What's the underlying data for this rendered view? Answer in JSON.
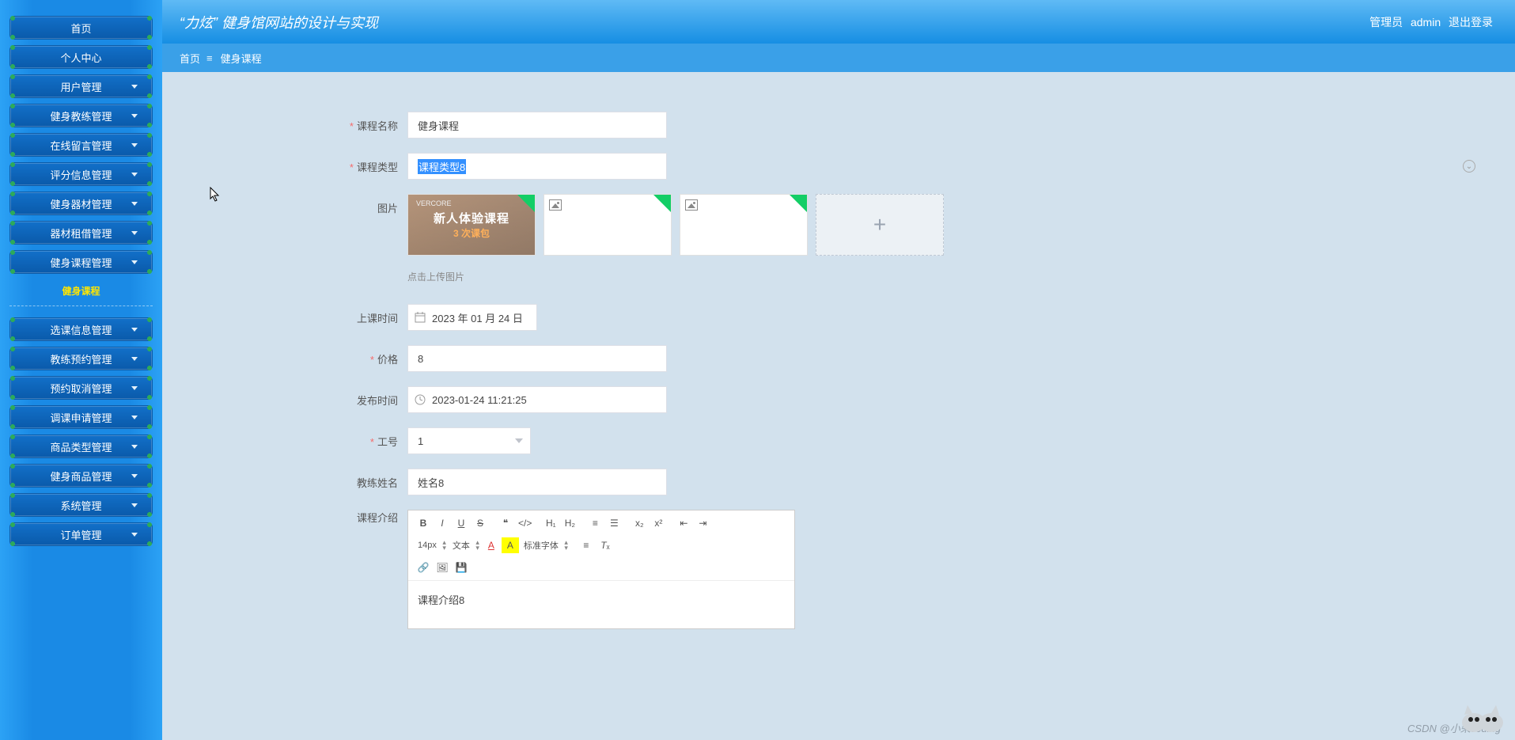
{
  "header": {
    "title": "“力炫” 健身馆网站的设计与实现",
    "role": "管理员",
    "user": "admin",
    "logout": "退出登录"
  },
  "breadcrumb": {
    "home": "首页",
    "current": "健身课程"
  },
  "sidebar": {
    "group1": [
      {
        "label": "首页"
      },
      {
        "label": "个人中心"
      },
      {
        "label": "用户管理",
        "sub": true
      },
      {
        "label": "健身教练管理",
        "sub": true
      },
      {
        "label": "在线留言管理",
        "sub": true
      },
      {
        "label": "评分信息管理",
        "sub": true
      },
      {
        "label": "健身器材管理",
        "sub": true
      },
      {
        "label": "器材租借管理",
        "sub": true
      },
      {
        "label": "健身课程管理",
        "sub": true
      }
    ],
    "active_sub": "健身课程",
    "group2": [
      {
        "label": "选课信息管理",
        "sub": true
      },
      {
        "label": "教练预约管理",
        "sub": true
      },
      {
        "label": "预约取消管理",
        "sub": true
      },
      {
        "label": "调课申请管理",
        "sub": true
      },
      {
        "label": "商品类型管理",
        "sub": true
      },
      {
        "label": "健身商品管理",
        "sub": true
      },
      {
        "label": "系统管理",
        "sub": true
      },
      {
        "label": "订单管理",
        "sub": true
      }
    ]
  },
  "form": {
    "course_name_label": "课程名称",
    "course_name_value": "健身课程",
    "course_type_label": "课程类型",
    "course_type_value": "课程类型8",
    "image_label": "图片",
    "thumb_brand": "VERCORE",
    "thumb_line1": "新人体验课程",
    "thumb_line2": "3 次课包",
    "upload_hint": "点击上传图片",
    "class_time_label": "上课时间",
    "class_time_value": "2023 年 01 月 24 日",
    "price_label": "价格",
    "price_value": "8",
    "publish_time_label": "发布时间",
    "publish_time_value": "2023-01-24 11:21:25",
    "job_no_label": "工号",
    "job_no_value": "1",
    "coach_name_label": "教练姓名",
    "coach_name_value": "姓名8",
    "intro_label": "课程介绍",
    "intro_value": "课程介绍8"
  },
  "editor_toolbar": {
    "font_size": "14px",
    "paragraph": "文本",
    "font_family": "标准字体"
  },
  "watermark": "CSDN @小荣coding"
}
